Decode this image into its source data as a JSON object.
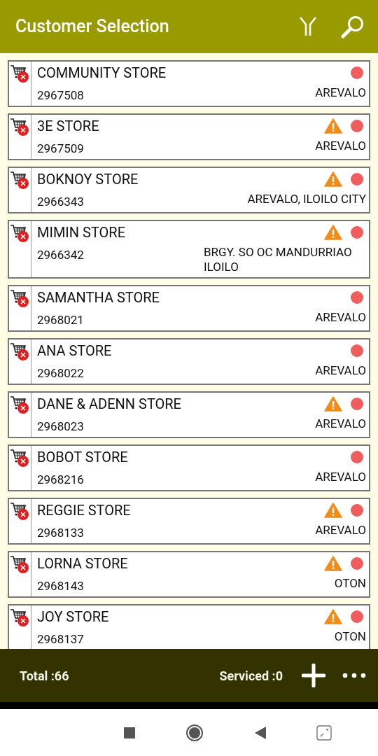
{
  "header": {
    "title": "Customer Selection"
  },
  "customers": [
    {
      "name": "COMMUNITY STORE",
      "code": "2967508",
      "area": "AREVALO",
      "warning": false
    },
    {
      "name": "3E STORE",
      "code": "2967509",
      "area": "AREVALO",
      "warning": true
    },
    {
      "name": "BOKNOY STORE",
      "code": "2966343",
      "area": "AREVALO, ILOILO CITY",
      "warning": true
    },
    {
      "name": "MIMIN STORE",
      "code": "2966342",
      "area": "BRGY. SO OC MANDURRIAO ILOILO",
      "warning": true
    },
    {
      "name": "SAMANTHA STORE",
      "code": "2968021",
      "area": "AREVALO",
      "warning": false
    },
    {
      "name": "ANA STORE",
      "code": "2968022",
      "area": "AREVALO",
      "warning": false
    },
    {
      "name": "DANE & ADENN STORE",
      "code": "2968023",
      "area": "AREVALO",
      "warning": true
    },
    {
      "name": "BOBOT STORE",
      "code": "2968216",
      "area": "AREVALO",
      "warning": false
    },
    {
      "name": "REGGIE STORE",
      "code": "2968133",
      "area": "AREVALO",
      "warning": true
    },
    {
      "name": "LORNA STORE",
      "code": "2968143",
      "area": "OTON",
      "warning": true
    },
    {
      "name": "JOY STORE",
      "code": "2968137",
      "area": "OTON",
      "warning": true
    }
  ],
  "footer": {
    "total": "Total :66",
    "serviced": "Serviced :0"
  }
}
